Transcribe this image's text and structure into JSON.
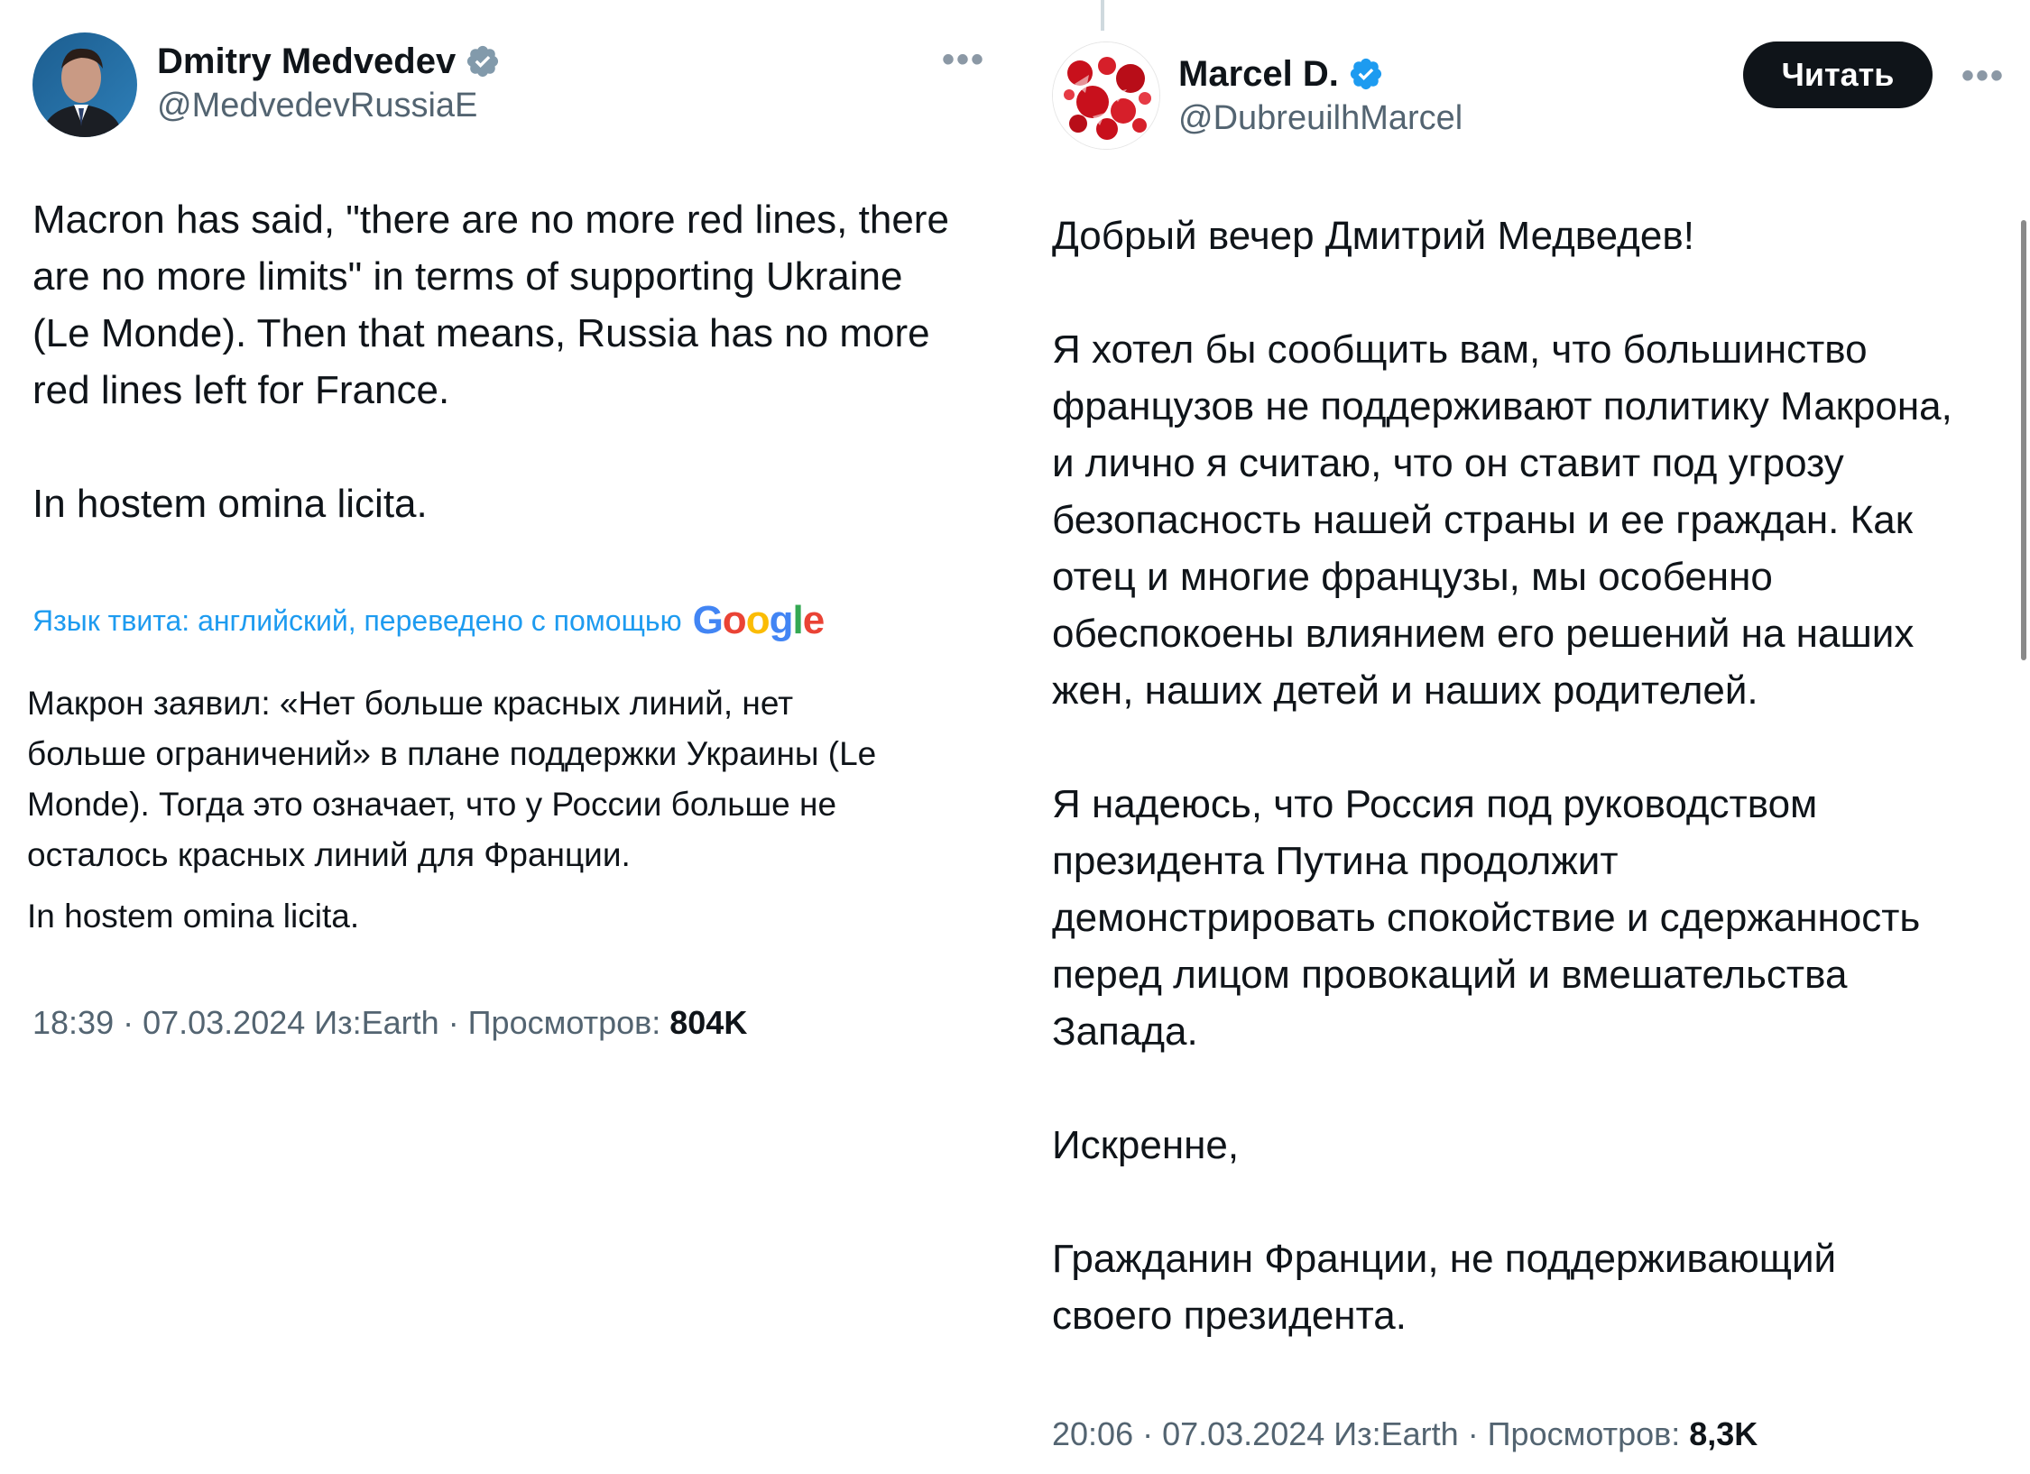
{
  "left_tweet": {
    "author_name": "Dmitry Medvedev",
    "author_handle": "@MedvedevRussiaE",
    "verified_badge": "gray-check-badge-icon",
    "text": "Macron has said, \"there are no more red lines, there\nare no more limits\" in terms of supporting Ukraine\n(Le Monde). Then that means, Russia has no more\nred lines left for France.\n\nIn hostem omina licita.",
    "translation_note": "Язык твита: английский, переведено с помощью",
    "translation_provider": "Google",
    "translated_text_p1": "Макрон заявил: «Нет больше красных линий, нет\nбольше ограничений» в плане поддержки Украины (Le\nMonde). Тогда это означает, что у России больше не\nосталось красных линий для Франции.",
    "translated_text_p2": "In hostem omina licita.",
    "timestamp": "18:39 · 07.03.2024 Из:Earth · Просмотров:",
    "views": "804K"
  },
  "right_tweet": {
    "author_name": "Marcel D.",
    "author_handle": "@DubreuilhMarcel",
    "verified_badge": "blue-check-badge-icon",
    "follow_label": "Читать",
    "text": "Добрый вечер Дмитрий Медведев!\n\nЯ хотел бы сообщить вам, что большинство\nфранцузов не поддерживают политику Макрона,\nи лично я считаю, что он ставит под угрозу\nбезопасность нашей страны и ее граждан. Как\nотец и многие французы, мы особенно\nобеспокоены влиянием его решений на наших\nжен, наших детей и наших родителей.\n\nЯ надеюсь, что Россия под руководством\nпрезидента Путина продолжит\nдемонстрировать спокойствие и сдержанность\nперед лицом провокаций и вмешательства\nЗапада.\n\nИскренне,\n\nГражданин Франции, не поддерживающий\nсвоего президента.",
    "timestamp": "20:06 · 07.03.2024 Из:Earth · Просмотров:",
    "views": "8,3K"
  },
  "colors": {
    "text_primary": "#0f1419",
    "text_secondary": "#536471",
    "link_blue": "#1d9bf0",
    "verified_blue": "#1d9bf0",
    "verified_gray": "#829aab",
    "button_dark": "#0f1419"
  }
}
